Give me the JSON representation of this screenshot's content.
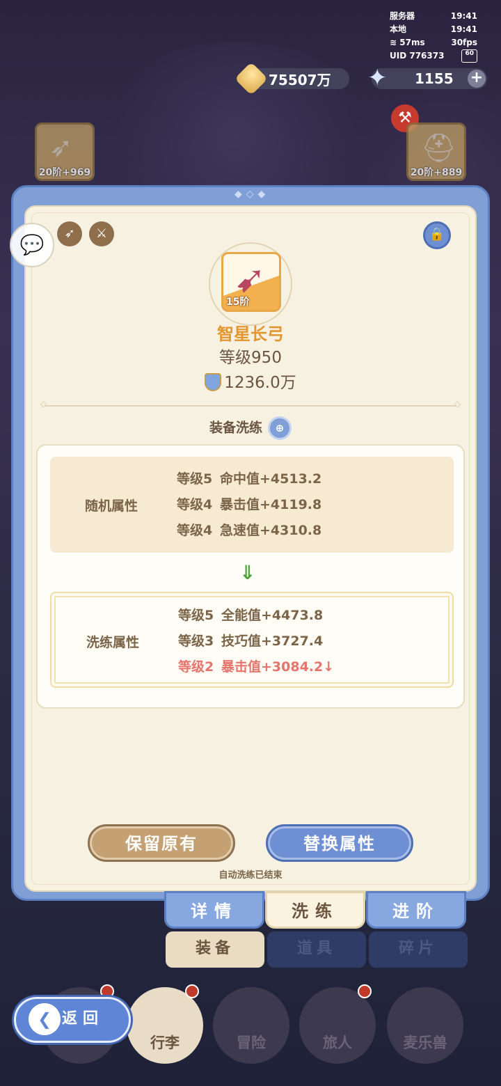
{
  "status": {
    "server_label": "服务器",
    "server_time": "19:41",
    "local_label": "本地",
    "local_time": "19:41",
    "ping": "57ms",
    "fps": "30fps",
    "uid": "UID 776373",
    "battery": "60"
  },
  "currency": {
    "gold": "75507万",
    "stars": "1155"
  },
  "slots": {
    "left_tier": "20阶+969",
    "right_tier": "20阶+889"
  },
  "item": {
    "tier": "15阶",
    "name": "智星长弓",
    "level": "等级950",
    "power": "1236.0万"
  },
  "section_title": "装备洗练",
  "random_attrs": {
    "label": "随机属性",
    "lines": [
      {
        "grade": "等级5",
        "stat": "命中值+4513.2"
      },
      {
        "grade": "等级4",
        "stat": "暴击值+4119.8"
      },
      {
        "grade": "等级4",
        "stat": "急速值+4310.8"
      }
    ]
  },
  "refine_attrs": {
    "label": "洗练属性",
    "lines": [
      {
        "grade": "等级5",
        "stat": "全能值+4473.8"
      },
      {
        "grade": "等级3",
        "stat": "技巧值+3727.4"
      },
      {
        "grade": "等级2",
        "stat": "暴击值+3084.2↓"
      }
    ]
  },
  "buttons": {
    "keep": "保留原有",
    "replace": "替换属性",
    "auto_note": "自动洗练已结束"
  },
  "tabs": {
    "detail": "详情",
    "refine": "洗练",
    "advance": "进阶"
  },
  "sub_tabs": {
    "equip": "装备",
    "items": "道具",
    "fragments": "碎片"
  },
  "nav": {
    "pack": "行李",
    "adventure": "冒险",
    "traveler": "旅人",
    "pet": "麦乐兽",
    "back": "返回"
  },
  "colors": {
    "accent_blue": "#7f9fd6",
    "gold_text": "#e3962f",
    "bad_stat": "#e6746b",
    "good_arrow": "#4ea33b"
  }
}
